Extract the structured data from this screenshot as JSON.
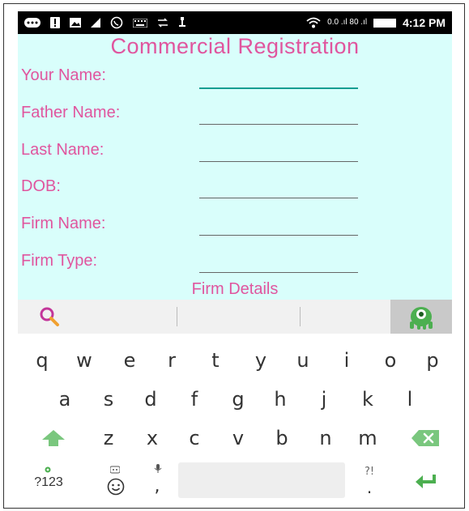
{
  "status_bar": {
    "time": "4:12 PM",
    "network": "0.0 .ıl 80 .ıl",
    "icons": [
      "keyboard-icon",
      "alert-icon",
      "image-icon",
      "signal-icon",
      "whatsapp-icon",
      "keyboard-icon",
      "transfer-icon",
      "usb-icon",
      "wifi-icon",
      "battery-icon"
    ]
  },
  "app": {
    "title": "Commercial Registration",
    "fields": [
      {
        "label": "Your Name:",
        "value": "",
        "focused": true
      },
      {
        "label": "Father Name:",
        "value": "",
        "focused": false
      },
      {
        "label": "Last Name:",
        "value": "",
        "focused": false
      },
      {
        "label": "DOB:",
        "value": "",
        "focused": false
      },
      {
        "label": "Firm Name:",
        "value": "",
        "focused": false
      },
      {
        "label": "Firm Type:",
        "value": "",
        "focused": false
      }
    ],
    "section_label": "Firm Details",
    "colors": {
      "accent": "#e0559e",
      "background": "#d9fefb",
      "focus_underline": "#179e91"
    }
  },
  "keyboard": {
    "row1": [
      "q",
      "w",
      "e",
      "r",
      "t",
      "y",
      "u",
      "i",
      "o",
      "p"
    ],
    "row2": [
      "a",
      "s",
      "d",
      "f",
      "g",
      "h",
      "j",
      "k",
      "l"
    ],
    "row3": [
      "z",
      "x",
      "c",
      "v",
      "b",
      "n",
      "m"
    ],
    "symbols_key": "?123",
    "punct_key": "?!",
    "comma_key": ",",
    "period_key": ".",
    "icons": [
      "search-icon",
      "mascot-icon",
      "shift-icon",
      "backspace-icon",
      "settings-icon",
      "emoji-icon",
      "mic-icon",
      "enter-icon"
    ]
  }
}
